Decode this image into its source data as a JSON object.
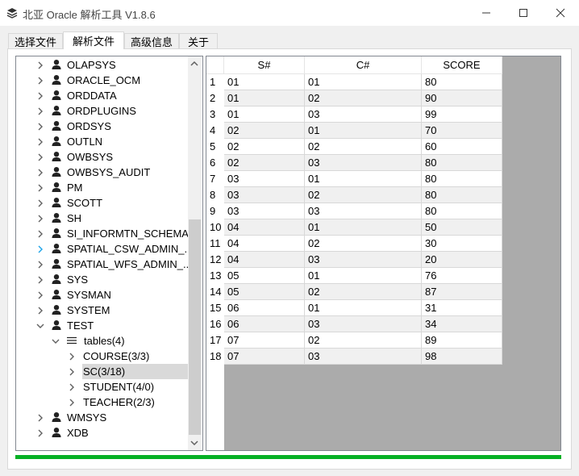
{
  "window": {
    "title": "北亚 Oracle 解析工具  V1.8.6",
    "icons": {
      "app": "layers-icon",
      "minimize": "minimize-icon",
      "maximize": "maximize-icon",
      "close": "close-icon"
    }
  },
  "tabs": [
    {
      "label": "选择文件",
      "active": false
    },
    {
      "label": "解析文件",
      "active": true
    },
    {
      "label": "高级信息",
      "active": false
    },
    {
      "label": "关于",
      "active": false
    }
  ],
  "tree": {
    "items": [
      {
        "label": "OLAPSYS",
        "expanded": false,
        "icon": "user-icon",
        "level": 0
      },
      {
        "label": "ORACLE_OCM",
        "expanded": false,
        "icon": "user-icon",
        "level": 0
      },
      {
        "label": "ORDDATA",
        "expanded": false,
        "icon": "user-icon",
        "level": 0
      },
      {
        "label": "ORDPLUGINS",
        "expanded": false,
        "icon": "user-icon",
        "level": 0
      },
      {
        "label": "ORDSYS",
        "expanded": false,
        "icon": "user-icon",
        "level": 0
      },
      {
        "label": "OUTLN",
        "expanded": false,
        "icon": "user-icon",
        "level": 0
      },
      {
        "label": "OWBSYS",
        "expanded": false,
        "icon": "user-icon",
        "level": 0
      },
      {
        "label": "OWBSYS_AUDIT",
        "expanded": false,
        "icon": "user-icon",
        "level": 0
      },
      {
        "label": "PM",
        "expanded": false,
        "icon": "user-icon",
        "level": 0
      },
      {
        "label": "SCOTT",
        "expanded": false,
        "icon": "user-icon",
        "level": 0
      },
      {
        "label": "SH",
        "expanded": false,
        "icon": "user-icon",
        "level": 0
      },
      {
        "label": "SI_INFORMTN_SCHEMA",
        "expanded": false,
        "icon": "user-icon",
        "level": 0
      },
      {
        "label": "SPATIAL_CSW_ADMIN_...",
        "expanded": false,
        "icon": "user-icon",
        "level": 0,
        "hover": true
      },
      {
        "label": "SPATIAL_WFS_ADMIN_...",
        "expanded": false,
        "icon": "user-icon",
        "level": 0
      },
      {
        "label": "SYS",
        "expanded": false,
        "icon": "user-icon",
        "level": 0
      },
      {
        "label": "SYSMAN",
        "expanded": false,
        "icon": "user-icon",
        "level": 0
      },
      {
        "label": "SYSTEM",
        "expanded": false,
        "icon": "user-icon",
        "level": 0
      },
      {
        "label": "TEST",
        "expanded": true,
        "icon": "user-icon",
        "level": 0
      },
      {
        "label": "tables(4)",
        "expanded": true,
        "icon": "list-icon",
        "level": 1
      },
      {
        "label": "COURSE(3/3)",
        "expanded": false,
        "icon": "",
        "level": 2
      },
      {
        "label": "SC(3/18)",
        "expanded": false,
        "icon": "",
        "level": 2,
        "selected": true
      },
      {
        "label": "STUDENT(4/0)",
        "expanded": false,
        "icon": "",
        "level": 2
      },
      {
        "label": "TEACHER(2/3)",
        "expanded": false,
        "icon": "",
        "level": 2
      },
      {
        "label": "WMSYS",
        "expanded": false,
        "icon": "user-icon",
        "level": 0
      },
      {
        "label": "XDB",
        "expanded": false,
        "icon": "user-icon",
        "level": 0
      }
    ]
  },
  "grid": {
    "columns": [
      "S#",
      "C#",
      "SCORE"
    ],
    "rows": [
      {
        "num": "1",
        "cells": [
          "01",
          "01",
          "80"
        ]
      },
      {
        "num": "2",
        "cells": [
          "01",
          "02",
          "90"
        ]
      },
      {
        "num": "3",
        "cells": [
          "01",
          "03",
          "99"
        ]
      },
      {
        "num": "4",
        "cells": [
          "02",
          "01",
          "70"
        ]
      },
      {
        "num": "5",
        "cells": [
          "02",
          "02",
          "60"
        ]
      },
      {
        "num": "6",
        "cells": [
          "02",
          "03",
          "80"
        ]
      },
      {
        "num": "7",
        "cells": [
          "03",
          "01",
          "80"
        ]
      },
      {
        "num": "8",
        "cells": [
          "03",
          "02",
          "80"
        ]
      },
      {
        "num": "9",
        "cells": [
          "03",
          "03",
          "80"
        ]
      },
      {
        "num": "10",
        "cells": [
          "04",
          "01",
          "50"
        ]
      },
      {
        "num": "11",
        "cells": [
          "04",
          "02",
          "30"
        ]
      },
      {
        "num": "12",
        "cells": [
          "04",
          "03",
          "20"
        ]
      },
      {
        "num": "13",
        "cells": [
          "05",
          "01",
          "76"
        ]
      },
      {
        "num": "14",
        "cells": [
          "05",
          "02",
          "87"
        ]
      },
      {
        "num": "15",
        "cells": [
          "06",
          "01",
          "31"
        ]
      },
      {
        "num": "16",
        "cells": [
          "06",
          "03",
          "34"
        ]
      },
      {
        "num": "17",
        "cells": [
          "07",
          "02",
          "89"
        ]
      },
      {
        "num": "18",
        "cells": [
          "07",
          "03",
          "98"
        ]
      }
    ]
  },
  "progress": {
    "value": 1.0,
    "color": "#06b025"
  }
}
